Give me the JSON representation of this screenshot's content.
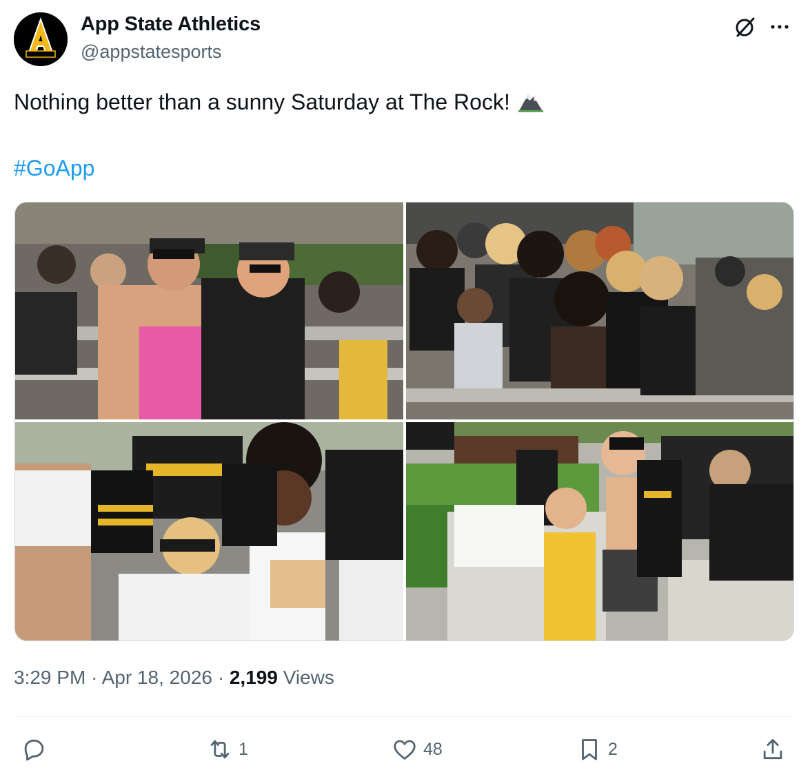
{
  "author": {
    "name": "App State Athletics",
    "handle": "@appstatesports",
    "avatar_icon": "app-state-a-logo",
    "avatar_logo_text": "A",
    "avatar_logo_subtext": "Mountaineers"
  },
  "header_icons": [
    "grok-icon",
    "more-icon"
  ],
  "tweet": {
    "text": "Nothing better than a sunny Saturday at The Rock!",
    "emoji_icon": "mountain-icon",
    "hashtag": "#GoApp"
  },
  "media": {
    "photos": [
      {
        "description": "fans-in-stands-1"
      },
      {
        "description": "fans-in-stands-2"
      },
      {
        "description": "fans-in-stands-3"
      },
      {
        "description": "kids-with-jerseys"
      }
    ]
  },
  "meta": {
    "time": "3:29 PM",
    "separator": "·",
    "date": "Apr 18, 2026",
    "views_count": "2,199",
    "views_label": "Views"
  },
  "actions": {
    "reply_count": "",
    "retweet_count": "1",
    "like_count": "48",
    "bookmark_count": "2"
  },
  "colors": {
    "link": "#1d9bf0",
    "secondary_text": "#536471",
    "primary_text": "#0f1419",
    "brand_gold": "#f2b719"
  }
}
